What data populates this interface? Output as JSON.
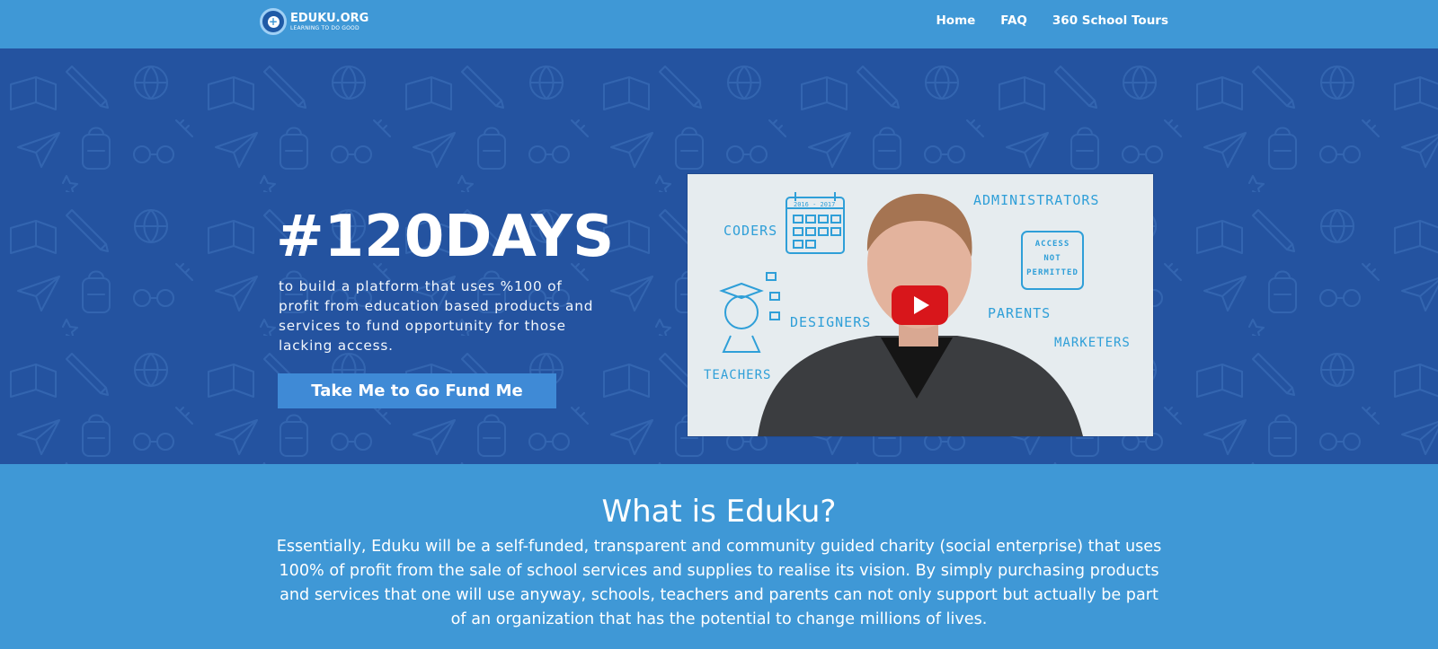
{
  "brand": {
    "name": "EDUKU.ORG",
    "tagline": "LEARNING TO DO GOOD",
    "icon": "plus-icon"
  },
  "nav": {
    "items": [
      {
        "label": "Home"
      },
      {
        "label": "FAQ"
      },
      {
        "label": "360 School Tours"
      }
    ]
  },
  "hero": {
    "title": "#120DAYS",
    "subtitle": "to build a platform that uses %100 of profit from education based products and services to fund opportunity for those lacking access.",
    "cta_label": "Take Me to Go Fund Me",
    "background_color": "#2453a0",
    "pattern_icons": [
      "book-icon",
      "pencil-icon",
      "globe-icon",
      "paper-plane-icon",
      "backpack-icon",
      "glasses-icon"
    ]
  },
  "video": {
    "whiteboard_words": [
      "CODERS",
      "ADMINISTRATORS",
      "DESIGNERS",
      "PARENTS",
      "MARKETERS",
      "TEACHERS"
    ],
    "sign_text": [
      "ACCESS",
      "NOT",
      "PERMITTED"
    ],
    "calendar_label": "2016 - 2017",
    "play_icon": "youtube-play-icon"
  },
  "about": {
    "title": "What is Eduku?",
    "text": "Essentially, Eduku will be a self-funded, transparent and community guided charity (social enterprise) that uses 100% of profit from the sale of school services and supplies to realise its vision. By simply purchasing products and services that one will use anyway, schools, teachers and parents can not only support but actually be part of an organization that has the potential to change millions of lives."
  },
  "colors": {
    "nav_bg": "#3f98d6",
    "hero_bg": "#2453a0",
    "cta_bg": "#3f8ad6",
    "play_red": "#d8161b"
  }
}
